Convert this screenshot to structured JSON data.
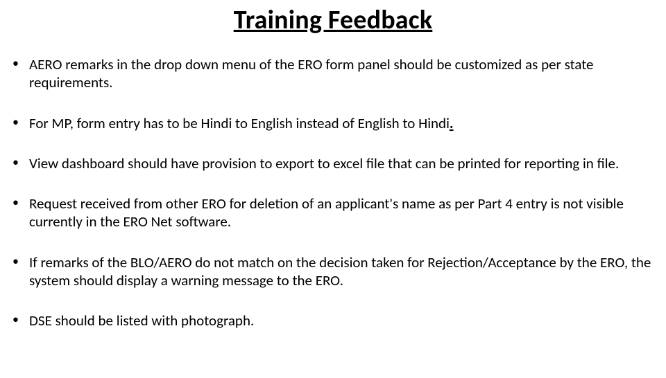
{
  "title": "Training Feedback",
  "bullets": [
    {
      "text": "AERO remarks in the drop down menu of the ERO form panel should be customized as per state requirements."
    },
    {
      "prefix": "For MP, form entry has to be Hindi to English instead of English to Hindi",
      "udot": "."
    },
    {
      "text": "View dashboard should have provision to export to excel file that can be printed for reporting in file."
    },
    {
      "text": "Request received from other ERO for deletion of an applicant's name as per Part 4 entry is not visible currently in the ERO Net software."
    },
    {
      "text": "If remarks of the BLO/AERO do not match on the decision taken for Rejection/Acceptance by the ERO, the system should display a warning message to the ERO."
    },
    {
      "text": "DSE should be listed with photograph."
    }
  ]
}
